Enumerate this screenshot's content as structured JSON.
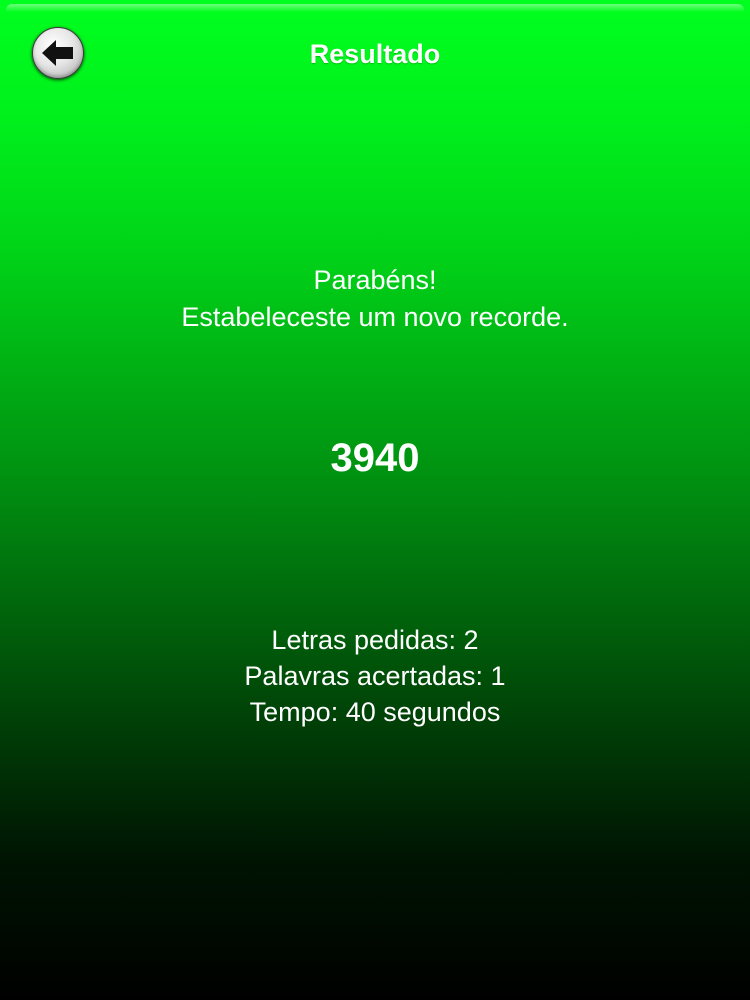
{
  "header": {
    "title": "Resultado",
    "back_icon": "back-arrow-icon"
  },
  "result": {
    "congrats": "Parabéns!",
    "record_message": "Estabeleceste um novo recorde.",
    "score": "3940"
  },
  "stats": {
    "letters_requested": "Letras pedidas: 2",
    "words_correct": "Palavras acertadas: 1",
    "time": "Tempo: 40 segundos"
  },
  "colors": {
    "gradient_top": "#00ff1e",
    "gradient_bottom": "#000000",
    "text": "#ffffff"
  }
}
